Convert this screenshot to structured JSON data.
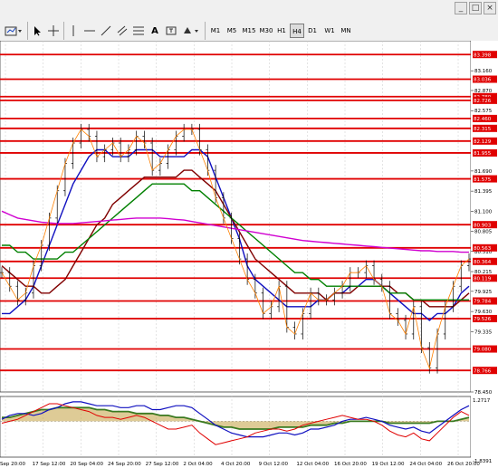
{
  "toolbar": {
    "timeframes": [
      "M1",
      "M5",
      "M15",
      "M30",
      "H1",
      "H4",
      "D1",
      "W1",
      "MN"
    ],
    "active_timeframe": "H4",
    "text_tool_label": "A",
    "window_buttons": [
      "_",
      "□",
      "×"
    ]
  },
  "colors": {
    "level_line": "#e00000",
    "label_bg": "#e00000",
    "price_line": "#000000",
    "ma_blue": "#1010c0",
    "ma_green": "#008000",
    "ma_darkred": "#800000",
    "ma_magenta": "#d000d0",
    "ma_orange": "#ff8000",
    "grid": "#c8c8c8"
  },
  "chart_data": [
    {
      "type": "line",
      "price_axis_ticks": [
        "83.160",
        "82.870",
        "82.575",
        "81.690",
        "81.395",
        "81.100",
        "80.805",
        "80.510",
        "80.215",
        "79.925",
        "79.630",
        "79.335",
        "78.450"
      ],
      "level_labels": [
        "83.398",
        "83.036",
        "82.780",
        "82.726",
        "82.460",
        "82.315",
        "82.129",
        "81.955",
        "81.575",
        "80.903",
        "80.563",
        "80.364",
        "80.119",
        "79.784",
        "79.526",
        "79.080",
        "78.766"
      ],
      "time_labels": [
        "Sep 20:00",
        "17 Sep 12:00",
        "20 Sep 04:00",
        "24 Sep 20:00",
        "27 Sep 12:00",
        "2 Oct 04:00",
        "4 Oct 20:00",
        "9 Oct 12:00",
        "12 Oct 04:00",
        "16 Oct 20:00",
        "19 Oct 12:00",
        "24 Oct 04:00",
        "26 Oct 20:00"
      ],
      "ylim": [
        78.45,
        83.6
      ],
      "price_series": [
        80.2,
        80.0,
        79.8,
        79.9,
        80.3,
        80.6,
        81.0,
        81.4,
        81.8,
        82.1,
        82.3,
        82.2,
        81.9,
        82.0,
        82.1,
        81.9,
        82.0,
        82.2,
        82.1,
        81.7,
        81.8,
        82.0,
        82.2,
        82.3,
        82.3,
        82.0,
        81.7,
        81.3,
        81.0,
        80.7,
        80.4,
        80.1,
        79.9,
        79.6,
        79.7,
        80.0,
        79.4,
        79.3,
        79.6,
        79.9,
        79.8,
        79.8,
        79.9,
        80.0,
        80.2,
        80.2,
        80.3,
        80.1,
        80.0,
        79.6,
        79.5,
        79.3,
        79.7,
        79.1,
        78.8,
        79.3,
        79.7,
        80.0,
        80.3,
        80.4
      ],
      "series": [
        {
          "values": [
            79.6,
            79.6,
            79.7,
            79.8,
            80.0,
            80.3,
            80.6,
            80.9,
            81.2,
            81.5,
            81.7,
            81.9,
            82.0,
            82.0,
            81.9,
            81.9,
            81.9,
            82.0,
            82.0,
            82.0,
            81.9,
            81.9,
            81.9,
            81.9,
            82.0,
            82.0,
            81.9,
            81.6,
            81.3,
            81.0,
            80.7,
            80.3,
            80.1,
            80.0,
            79.9,
            79.8,
            79.7,
            79.7,
            79.7,
            79.7,
            79.8,
            79.8,
            79.9,
            79.9,
            80.0,
            80.0,
            80.1,
            80.1,
            80.0,
            79.9,
            79.8,
            79.7,
            79.6,
            79.6,
            79.5,
            79.6,
            79.6,
            79.7,
            79.9,
            80.0
          ]
        },
        {
          "values": [
            80.3,
            80.2,
            80.1,
            80.0,
            80.0,
            79.9,
            79.9,
            80.0,
            80.1,
            80.3,
            80.5,
            80.7,
            80.9,
            81.0,
            81.2,
            81.3,
            81.4,
            81.5,
            81.6,
            81.6,
            81.6,
            81.6,
            81.6,
            81.7,
            81.7,
            81.6,
            81.5,
            81.4,
            81.2,
            81.0,
            80.8,
            80.6,
            80.4,
            80.3,
            80.2,
            80.1,
            80.0,
            79.9,
            79.9,
            79.9,
            79.9,
            79.8,
            79.9,
            79.9,
            79.9,
            80.0,
            80.0,
            80.0,
            80.0,
            80.0,
            79.9,
            79.9,
            79.8,
            79.8,
            79.7,
            79.7,
            79.7,
            79.7,
            79.8,
            79.9
          ]
        },
        {
          "values": [
            80.6,
            80.6,
            80.5,
            80.5,
            80.4,
            80.4,
            80.4,
            80.4,
            80.5,
            80.5,
            80.6,
            80.7,
            80.8,
            80.9,
            81.0,
            81.1,
            81.2,
            81.3,
            81.4,
            81.5,
            81.5,
            81.5,
            81.5,
            81.5,
            81.4,
            81.4,
            81.3,
            81.2,
            81.1,
            81.0,
            80.9,
            80.8,
            80.7,
            80.6,
            80.5,
            80.4,
            80.3,
            80.2,
            80.2,
            80.1,
            80.1,
            80.0,
            80.0,
            80.0,
            80.0,
            80.0,
            80.0,
            80.0,
            80.0,
            79.9,
            79.9,
            79.9,
            79.8,
            79.8,
            79.8,
            79.8,
            79.8,
            79.8,
            79.8,
            79.8
          ]
        },
        {
          "values": [
            81.1,
            81.05,
            81.0,
            80.98,
            80.96,
            80.94,
            80.93,
            80.92,
            80.92,
            80.92,
            80.93,
            80.94,
            80.95,
            80.96,
            80.97,
            80.98,
            80.99,
            81.0,
            81.0,
            81.0,
            81.0,
            80.99,
            80.98,
            80.97,
            80.95,
            80.93,
            80.91,
            80.89,
            80.87,
            80.85,
            80.83,
            80.81,
            80.79,
            80.77,
            80.75,
            80.73,
            80.71,
            80.69,
            80.67,
            80.66,
            80.65,
            80.64,
            80.63,
            80.62,
            80.61,
            80.6,
            80.59,
            80.58,
            80.57,
            80.56,
            80.55,
            80.54,
            80.53,
            80.52,
            80.52,
            80.51,
            80.51,
            80.51,
            80.5,
            80.5
          ]
        }
      ]
    },
    {
      "type": "line",
      "title": "",
      "ylim": [
        -1.8391,
        1.2717
      ],
      "tick_labels": [
        "1.2717",
        "-1.8391"
      ],
      "series": [
        {
          "values": [
            0.1,
            0.3,
            0.4,
            0.4,
            0.3,
            0.4,
            0.6,
            0.7,
            0.9,
            1.0,
            1.0,
            0.9,
            0.8,
            0.8,
            0.8,
            0.7,
            0.7,
            0.8,
            0.8,
            0.6,
            0.6,
            0.7,
            0.8,
            0.8,
            0.7,
            0.4,
            0.1,
            -0.2,
            -0.4,
            -0.6,
            -0.7,
            -0.8,
            -0.8,
            -0.8,
            -0.7,
            -0.6,
            -0.6,
            -0.7,
            -0.6,
            -0.4,
            -0.4,
            -0.3,
            -0.2,
            0.0,
            0.1,
            0.1,
            0.2,
            0.1,
            0.0,
            -0.2,
            -0.3,
            -0.4,
            -0.3,
            -0.5,
            -0.6,
            -0.3,
            0.0,
            0.3,
            0.6,
            0.8
          ]
        },
        {
          "values": [
            0.2,
            0.2,
            0.3,
            0.4,
            0.5,
            0.6,
            0.6,
            0.7,
            0.7,
            0.7,
            0.7,
            0.7,
            0.6,
            0.6,
            0.5,
            0.5,
            0.5,
            0.4,
            0.4,
            0.4,
            0.3,
            0.3,
            0.2,
            0.2,
            0.1,
            0.0,
            -0.1,
            -0.2,
            -0.3,
            -0.3,
            -0.4,
            -0.4,
            -0.4,
            -0.4,
            -0.4,
            -0.3,
            -0.3,
            -0.3,
            -0.3,
            -0.2,
            -0.2,
            -0.2,
            -0.1,
            -0.1,
            0.0,
            0.0,
            0.0,
            0.0,
            0.0,
            -0.1,
            -0.1,
            -0.1,
            -0.1,
            -0.1,
            -0.1,
            0.0,
            0.0,
            0.0,
            0.1,
            0.2
          ]
        },
        {
          "values": [
            -0.1,
            0.0,
            0.1,
            0.3,
            0.5,
            0.7,
            0.9,
            0.9,
            0.8,
            0.7,
            0.6,
            0.5,
            0.3,
            0.2,
            0.2,
            0.1,
            0.2,
            0.3,
            0.2,
            0.0,
            -0.2,
            -0.4,
            -0.4,
            -0.3,
            -0.2,
            -0.6,
            -0.9,
            -1.2,
            -1.1,
            -1.0,
            -0.9,
            -0.8,
            -0.6,
            -0.5,
            -0.4,
            -0.4,
            -0.5,
            -0.4,
            -0.2,
            -0.1,
            0.0,
            0.1,
            0.2,
            0.3,
            0.2,
            0.1,
            0.1,
            0.0,
            -0.2,
            -0.5,
            -0.7,
            -0.8,
            -0.6,
            -0.9,
            -1.0,
            -0.6,
            -0.2,
            0.2,
            0.5,
            0.3
          ]
        }
      ]
    }
  ]
}
